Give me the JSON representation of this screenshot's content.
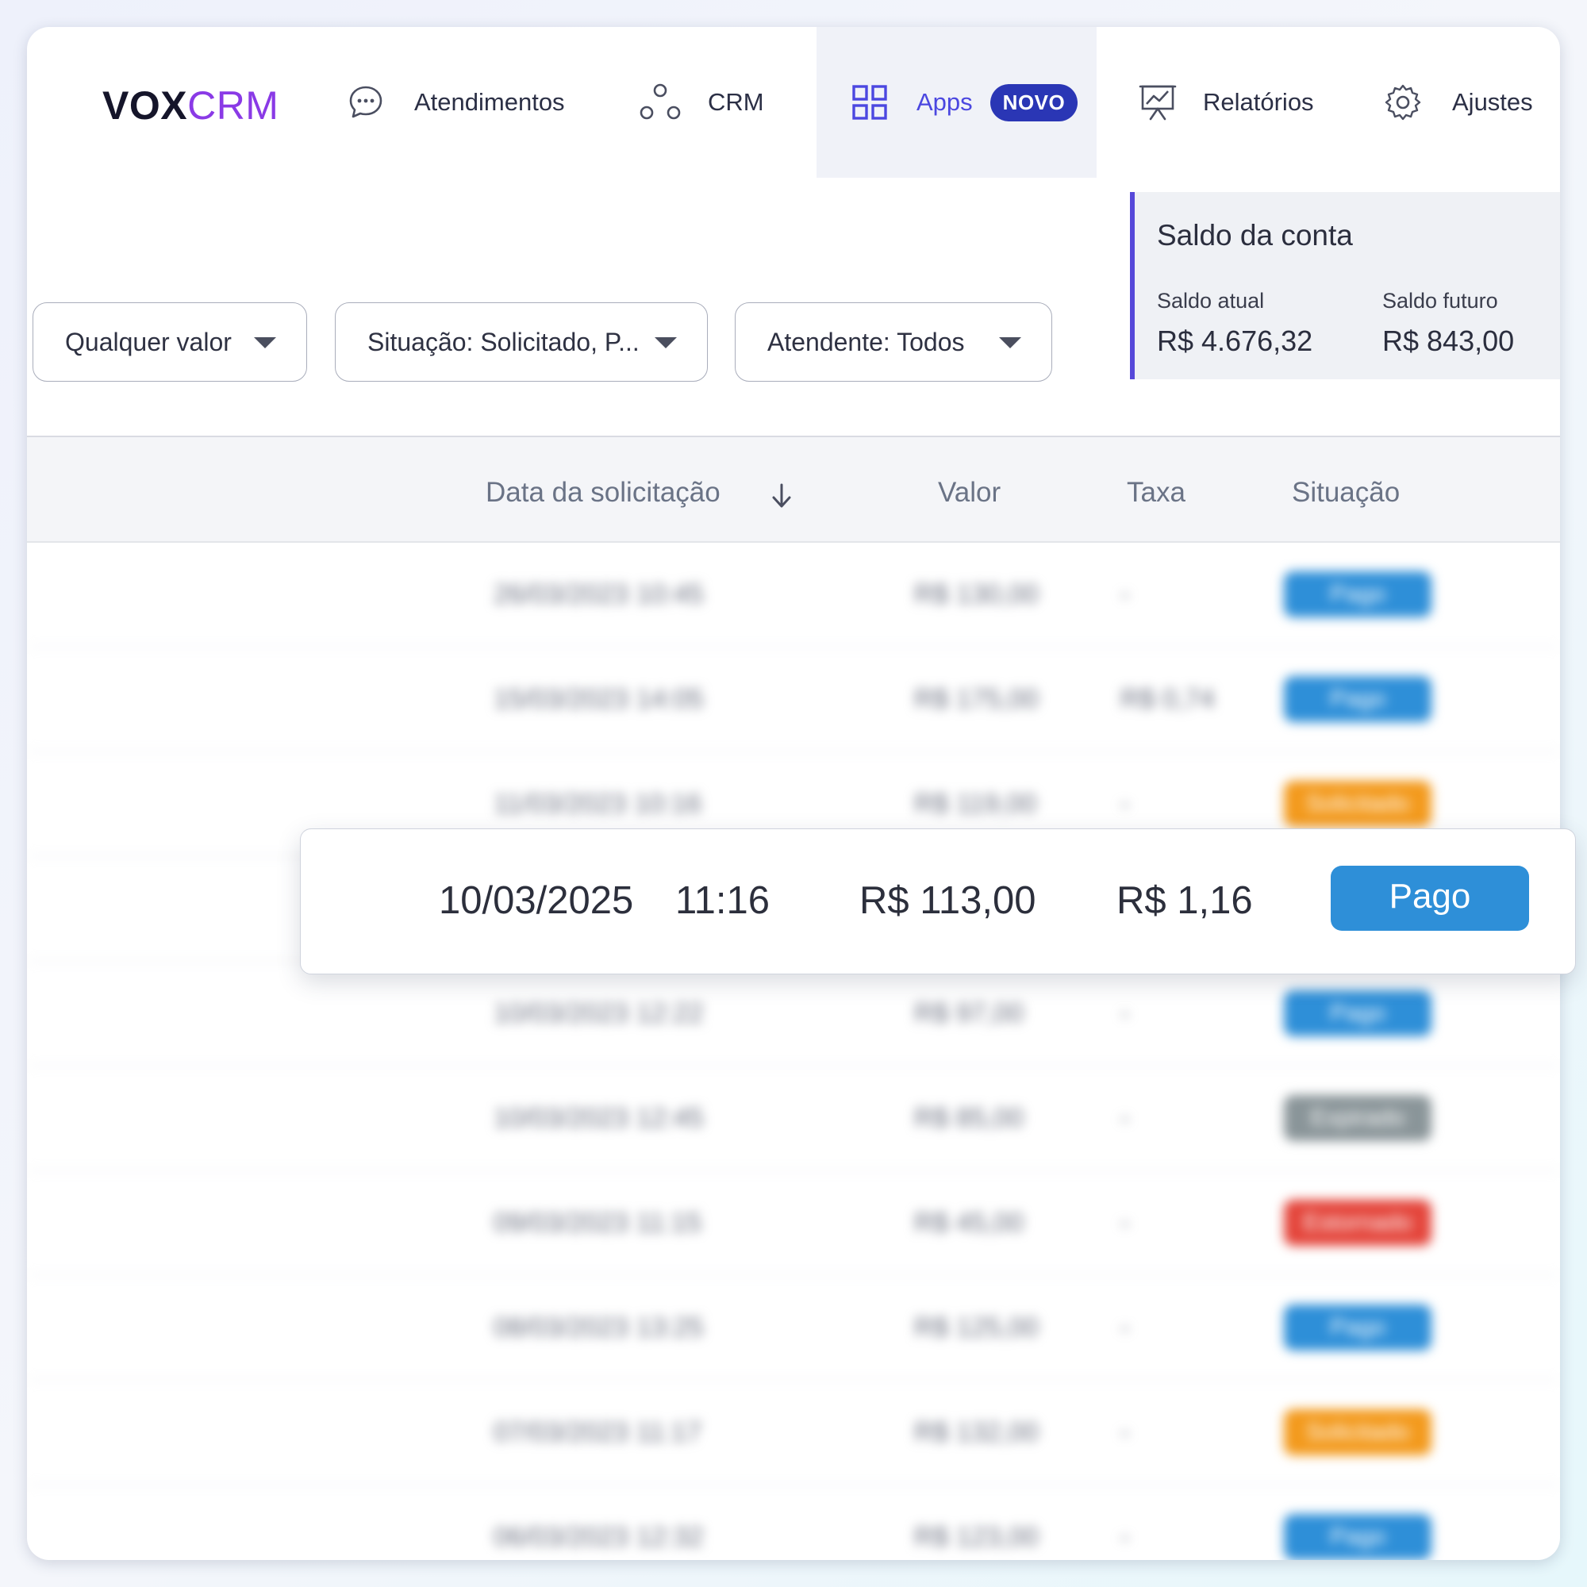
{
  "brand": {
    "part1": "VOX",
    "part2": "CRM"
  },
  "nav": {
    "atendimentos": "Atendimentos",
    "crm": "CRM",
    "apps": "Apps",
    "apps_badge": "NOVO",
    "relatorios": "Relatórios",
    "ajustes": "Ajustes"
  },
  "filters": {
    "valor": "Qualquer valor",
    "situacao": "Situação: Solicitado, P...",
    "atendente": "Atendente: Todos"
  },
  "balance": {
    "title": "Saldo da conta",
    "current_label": "Saldo atual",
    "current_value": "R$ 4.676,32",
    "future_label": "Saldo futuro",
    "future_value": "R$ 843,00"
  },
  "table": {
    "headers": {
      "date": "Data da solicitação",
      "value": "Valor",
      "fee": "Taxa",
      "status": "Situação"
    },
    "rows": [
      {
        "date": "26/03/2023  10:45",
        "value": "R$ 130,00",
        "fee": "-",
        "status": "Pago"
      },
      {
        "date": "15/03/2023  14:05",
        "value": "R$ 175,00",
        "fee": "R$ 0,74",
        "status": "Pago"
      },
      {
        "date": "11/03/2023  10:16",
        "value": "R$ 119,00",
        "fee": "-",
        "status": "Solicitado"
      },
      {
        "date": "10/03/2025  11:16",
        "value": "R$ 113,00",
        "fee": "R$ 1,16",
        "status": "Pago"
      },
      {
        "date": "10/03/2023  12:22",
        "value": "R$ 97,00",
        "fee": "-",
        "status": "Pago"
      },
      {
        "date": "10/03/2023  12:45",
        "value": "R$ 85,00",
        "fee": "-",
        "status": "Expirado"
      },
      {
        "date": "09/03/2023  11:15",
        "value": "R$ 45,00",
        "fee": "-",
        "status": "Estornado"
      },
      {
        "date": "08/03/2023  13:25",
        "value": "R$ 125,00",
        "fee": "-",
        "status": "Pago"
      },
      {
        "date": "07/03/2023  11:17",
        "value": "R$ 132,00",
        "fee": "-",
        "status": "Solicitado"
      },
      {
        "date": "06/03/2023  12:32",
        "value": "R$ 123,00",
        "fee": "-",
        "status": "Pago"
      }
    ]
  },
  "highlight": {
    "date": "10/03/2025",
    "time": "11:16",
    "value": "R$ 113,00",
    "fee": "R$ 1,16",
    "status": "Pago"
  },
  "status_colors": {
    "Pago": "#2e8fd8",
    "Solicitado": "#f39a1d",
    "Expirado": "#8a9599",
    "Estornado": "#e4453b"
  },
  "colors": {
    "accent": "#5648d9",
    "brand_purple": "#8a3ae6",
    "badge": "#2a36b5"
  }
}
